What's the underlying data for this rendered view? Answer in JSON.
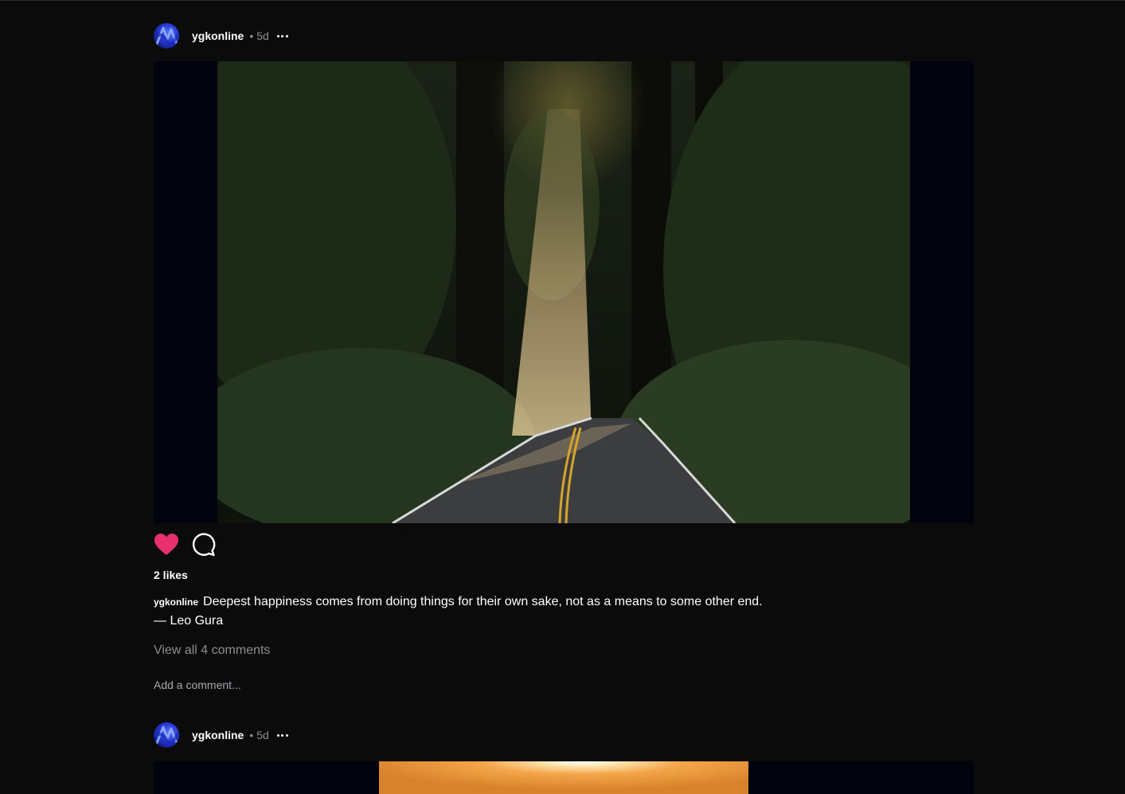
{
  "posts": [
    {
      "username": "ygkonline",
      "separator": "•",
      "time": "5d",
      "likes": "2 likes",
      "caption_user": "ygkonline",
      "caption_line1": "Deepest happiness comes from doing things for their own sake, not as a means to some other end.",
      "caption_line2": "— Leo Gura",
      "view_comments": "View all 4 comments",
      "add_comment_placeholder": "Add a comment..."
    },
    {
      "username": "ygkonline",
      "separator": "•",
      "time": "5d"
    }
  ],
  "colors": {
    "background": "#0b0b0c",
    "like_active": "#e8306f",
    "muted_text": "#8e8e92"
  },
  "icons": [
    "avatar",
    "more-icon",
    "heart-icon",
    "comment-icon"
  ]
}
